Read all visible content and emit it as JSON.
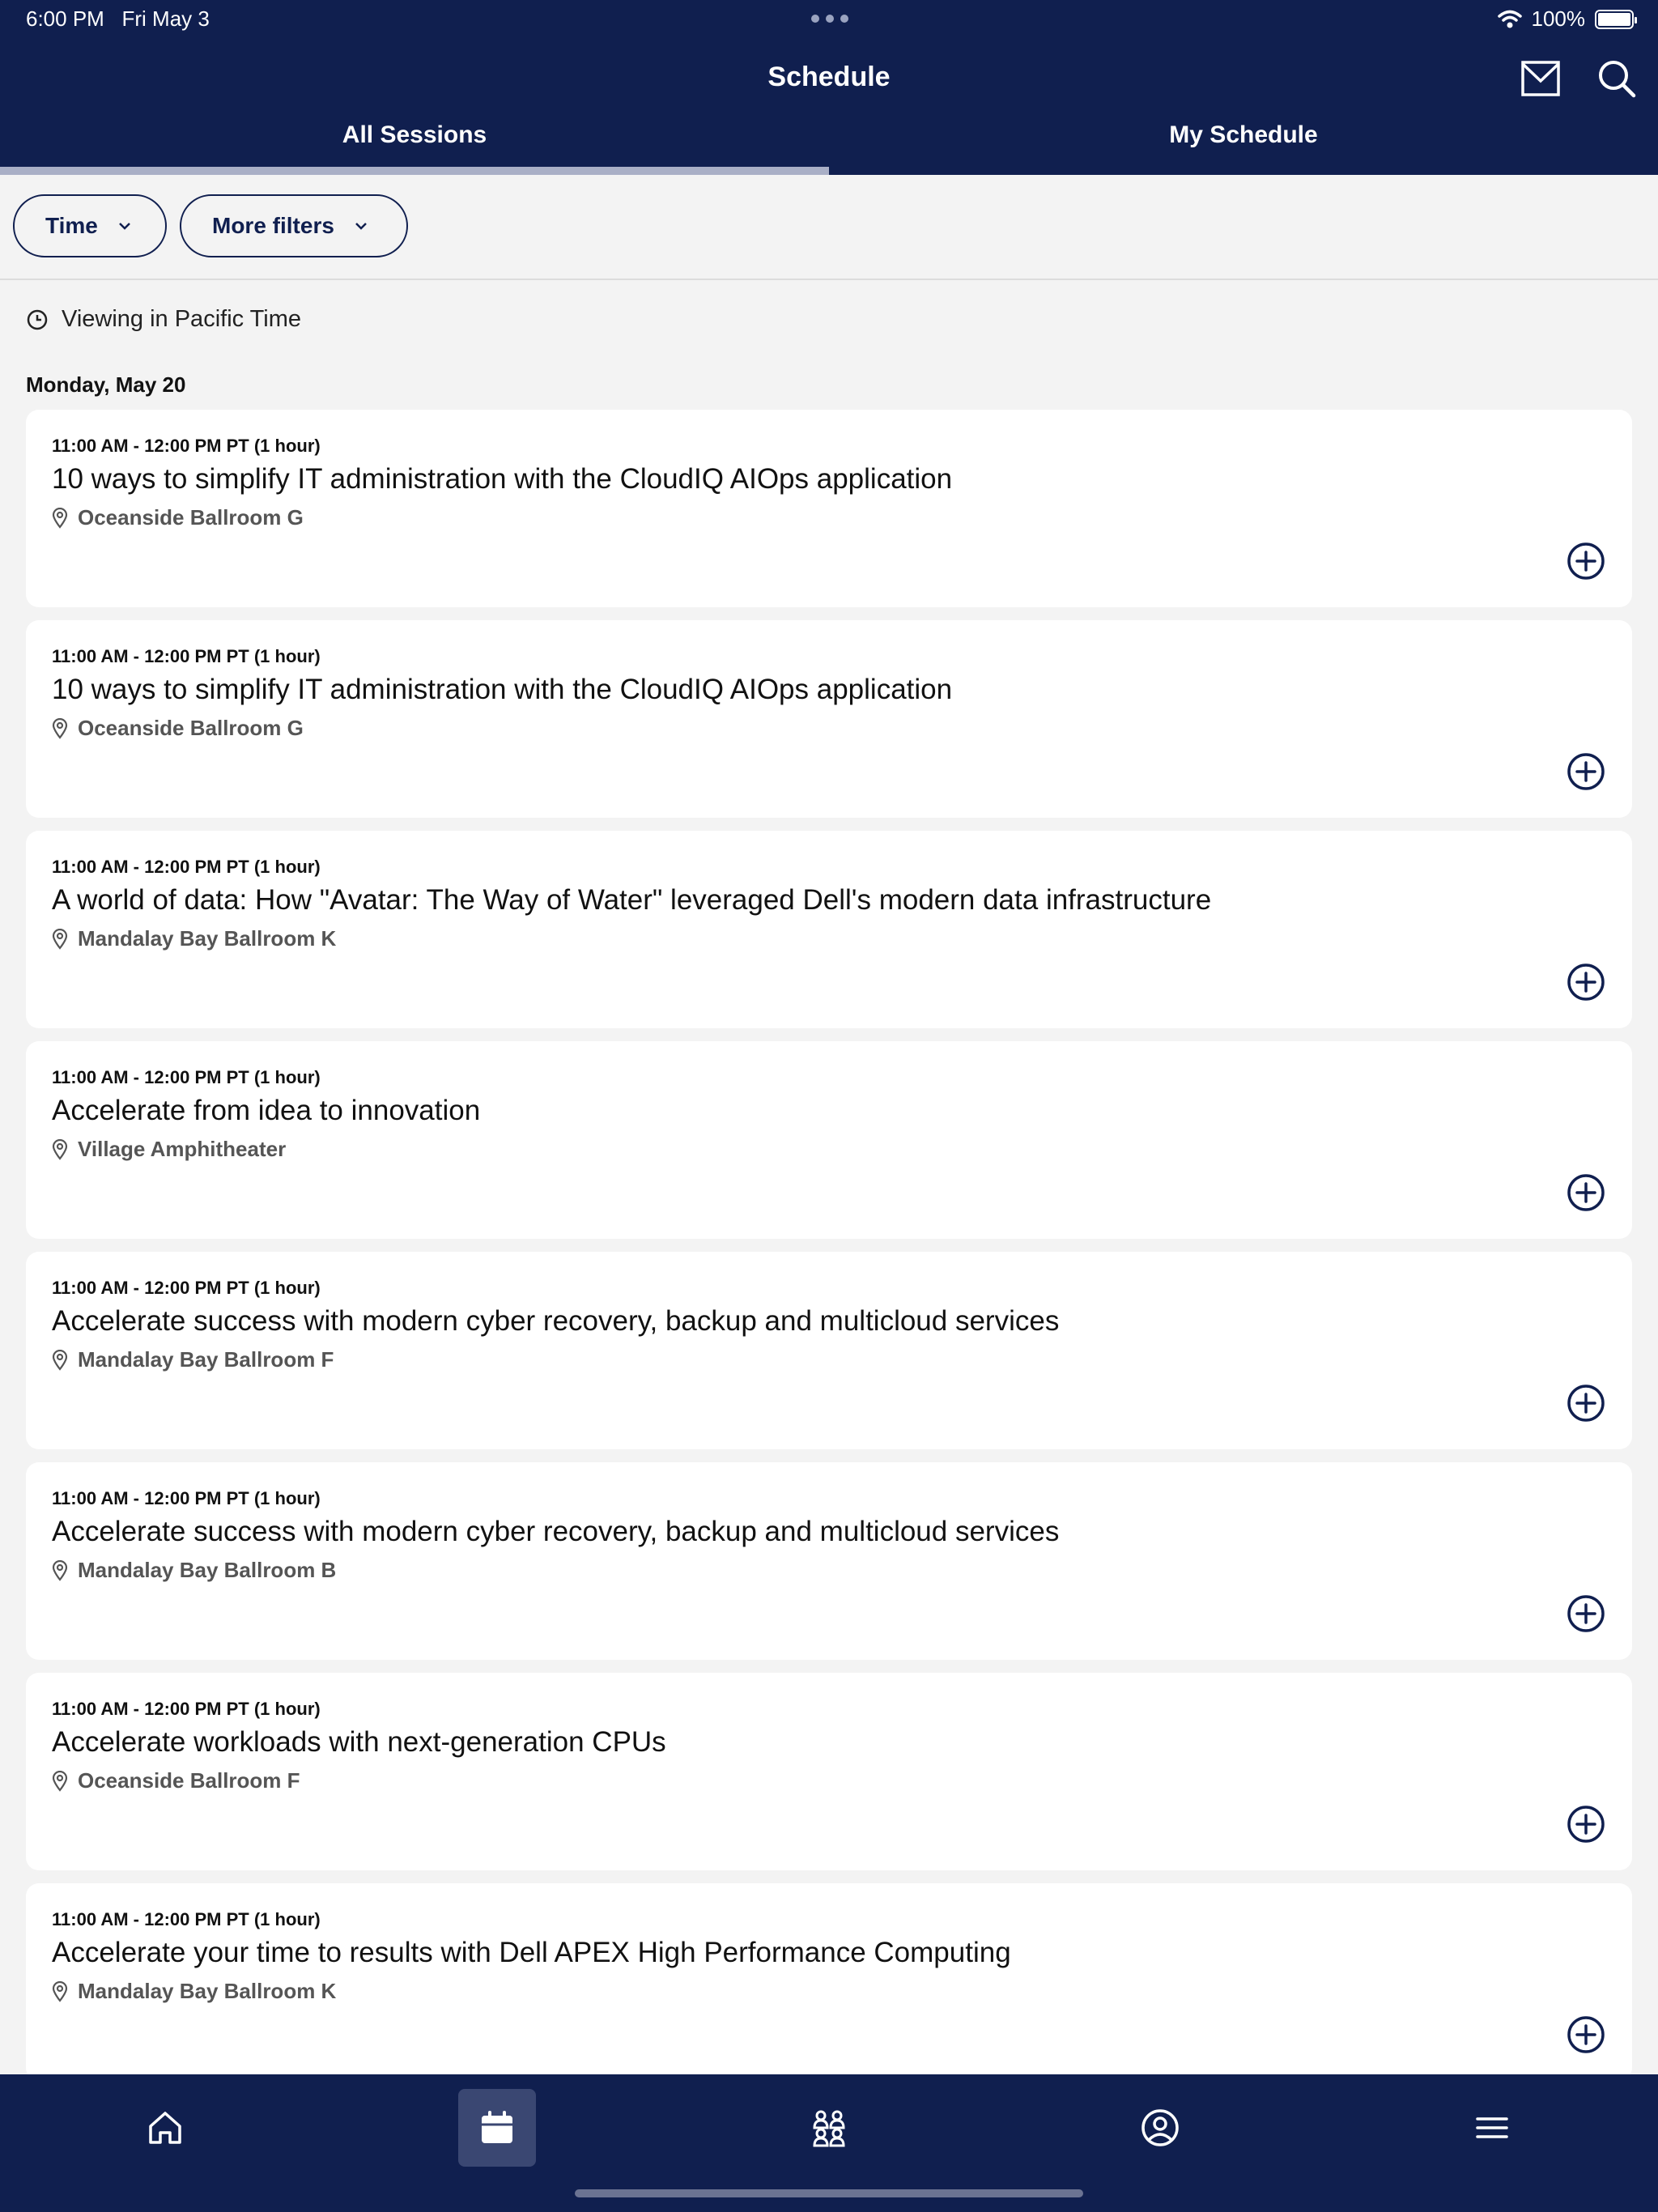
{
  "status_bar": {
    "time": "6:00 PM",
    "date": "Fri May 3",
    "battery": "100%",
    "battery_level": 1.0
  },
  "header": {
    "title": "Schedule",
    "icons": [
      "mail-icon",
      "search-icon"
    ]
  },
  "tabs": [
    {
      "label": "All Sessions",
      "active": true
    },
    {
      "label": "My Schedule",
      "active": false
    }
  ],
  "filters": {
    "time_label": "Time",
    "more_label": "More filters"
  },
  "timezone_note": "Viewing in Pacific Time",
  "day_heading": "Monday, May 20",
  "sessions": [
    {
      "time": "11:00 AM - 12:00 PM PT (1 hour)",
      "title": "10 ways to simplify IT administration with the CloudIQ AIOps application",
      "location": "Oceanside Ballroom G"
    },
    {
      "time": "11:00 AM - 12:00 PM PT (1 hour)",
      "title": "10 ways to simplify IT administration with the CloudIQ AIOps application",
      "location": "Oceanside Ballroom G"
    },
    {
      "time": "11:00 AM - 12:00 PM PT (1 hour)",
      "title": "A world of data: How \"Avatar: The Way of Water\" leveraged Dell's modern data infrastructure",
      "location": "Mandalay Bay Ballroom K"
    },
    {
      "time": "11:00 AM - 12:00 PM PT (1 hour)",
      "title": "Accelerate from idea to innovation",
      "location": "Village Amphitheater"
    },
    {
      "time": "11:00 AM - 12:00 PM PT (1 hour)",
      "title": "Accelerate success with modern cyber recovery, backup and multicloud services",
      "location": "Mandalay Bay Ballroom F"
    },
    {
      "time": "11:00 AM - 12:00 PM PT (1 hour)",
      "title": "Accelerate success with modern cyber recovery, backup and multicloud services",
      "location": "Mandalay Bay Ballroom B"
    },
    {
      "time": "11:00 AM - 12:00 PM PT (1 hour)",
      "title": "Accelerate workloads with next-generation CPUs",
      "location": "Oceanside Ballroom F"
    },
    {
      "time": "11:00 AM - 12:00 PM PT (1 hour)",
      "title": "Accelerate your time to results with Dell APEX High Performance Computing",
      "location": "Mandalay Bay Ballroom K"
    }
  ],
  "tab_bar": [
    {
      "icon": "home-icon",
      "active": false
    },
    {
      "icon": "calendar-icon",
      "active": true
    },
    {
      "icon": "people-icon",
      "active": false
    },
    {
      "icon": "profile-icon",
      "active": false
    },
    {
      "icon": "menu-icon",
      "active": false
    }
  ],
  "colors": {
    "navy": "#101f4f",
    "tab_active_bg": "#3a4772",
    "background": "#f3f3f3",
    "card": "#ffffff"
  }
}
